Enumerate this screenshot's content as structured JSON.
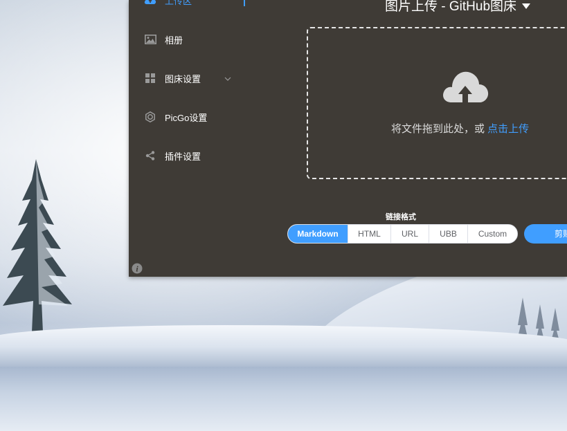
{
  "window_title": "图片上传 - GitHub图床",
  "sidebar": {
    "items": [
      {
        "label": "上传区",
        "icon": "cloud-upload-icon",
        "active": true
      },
      {
        "label": "相册",
        "icon": "image-icon"
      },
      {
        "label": "图床设置",
        "icon": "grid-icon"
      },
      {
        "label": "PicGo设置",
        "icon": "settings-cog-icon"
      },
      {
        "label": "插件设置",
        "icon": "share-icon"
      }
    ]
  },
  "upload": {
    "hint": "将文件拖到此处，或 ",
    "link": "点击上传"
  },
  "link_format": {
    "label": "链接格式",
    "options": [
      "Markdown",
      "HTML",
      "URL",
      "UBB",
      "Custom"
    ],
    "selected": "Markdown"
  },
  "clipboard_button": "剪贴",
  "colors": {
    "window_bg": "#3f3b36",
    "accent": "#409eff"
  }
}
